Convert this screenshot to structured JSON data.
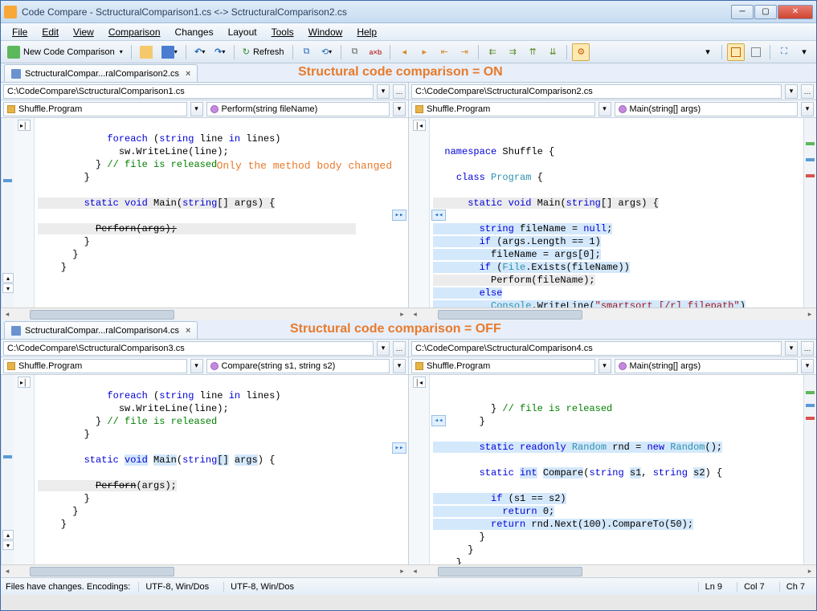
{
  "window": {
    "title": "Code Compare - SctructuralComparison1.cs <-> SctructuralComparison2.cs"
  },
  "menu": {
    "file": "File",
    "edit": "Edit",
    "view": "View",
    "comparison": "Comparison",
    "changes": "Changes",
    "layout": "Layout",
    "tools": "Tools",
    "window": "Window",
    "help": "Help"
  },
  "toolbar": {
    "new_compare": "New Code Comparison",
    "refresh": "Refresh"
  },
  "top": {
    "tab_label": "SctructuralCompar...ralComparison2.cs",
    "annotation": "Structural code comparison = ON",
    "left_path": "C:\\CodeCompare\\SctructuralComparison1.cs",
    "right_path": "C:\\CodeCompare\\SctructuralComparison2.cs",
    "left_class": "Shuffle.Program",
    "left_method": "Perform(string fileName)",
    "right_class": "Shuffle.Program",
    "right_method": "Main(string[] args)",
    "body_note": "Only the method body changed"
  },
  "bottom": {
    "tab_label": "SctructuralCompar...ralComparison4.cs",
    "annotation": "Structural code comparison = OFF",
    "left_path": "C:\\CodeCompare\\SctructuralComparison3.cs",
    "right_path": "C:\\CodeCompare\\SctructuralComparison4.cs",
    "left_class": "Shuffle.Program",
    "left_method": "Compare(string s1, string s2)",
    "right_class": "Shuffle.Program",
    "right_method": "Main(string[] args)"
  },
  "status": {
    "msg": "Files have changes. Encodings:",
    "enc1": "UTF-8, Win/Dos",
    "enc2": "UTF-8, Win/Dos",
    "ln": "Ln 9",
    "col": "Col 7",
    "ch": "Ch 7"
  }
}
